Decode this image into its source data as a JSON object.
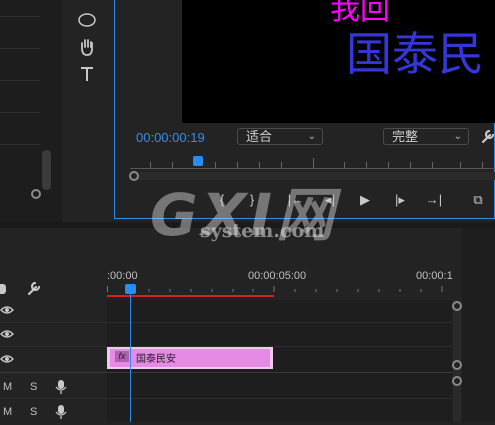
{
  "monitor": {
    "video_text_top": "我回",
    "video_text_main": "国泰民",
    "timecode": "00:00:00:19",
    "fit_dropdown": "适合",
    "quality_dropdown": "完整"
  },
  "transport": {
    "mark_in": "{",
    "mark_out": "}",
    "go_to_in": "|←",
    "step_back": "◂|",
    "play": "▶",
    "step_forward": "|▸",
    "go_to_out": "→|",
    "export_frame": "⧉"
  },
  "timeline": {
    "ruler_labels": [
      ":00:00",
      "00:00:05:00",
      "00:00:1"
    ],
    "track_mute_label": "M",
    "track_solo_label": "S",
    "clip_fx": "fx",
    "clip_name": "国泰民安"
  },
  "watermark": {
    "logo": "GXI网",
    "site": "system.com"
  },
  "colors": {
    "accent": "#2d8ceb",
    "clip": "#e58ae5",
    "in_out_bar": "#d42020"
  },
  "icons": [
    "ellipse-tool-icon",
    "hand-tool-icon",
    "type-tool-icon",
    "wrench-icon",
    "eye-icon",
    "microphone-icon"
  ]
}
